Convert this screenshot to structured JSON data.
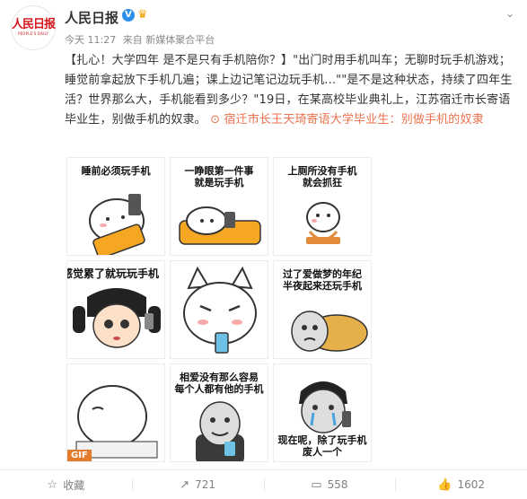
{
  "account": {
    "logo_text": "人民日报",
    "logo_sub": "PEOPLE'S DAILY",
    "name": "人民日报",
    "verified_mark": "V",
    "badge_icon": "crown-icon"
  },
  "post": {
    "time": "今天 11:27",
    "source": "来自 新媒体聚合平台",
    "text": "【扎心！大学四年 是不是只有手机陪你？】\"出门时用手机叫车；无聊时玩手机游戏；睡觉前拿起放下手机几遍；课上边记笔记边玩手机...\"\"是不是这种状态，持续了四年生活？世界那么大，手机能看到多少？\"19日，在某高校毕业典礼上，江苏宿迁市长寄语毕业生，别做手机的奴隶。",
    "link_text": "宿迁市长王天琦寄语大学毕业生：别做手机的奴隶"
  },
  "images": [
    {
      "caption": "睡前必须玩手机"
    },
    {
      "caption": "一睁眼第一件事\n就是玩手机"
    },
    {
      "caption": "上厕所没有手机\n就会抓狂"
    },
    {
      "caption": "感觉累了就玩玩手机"
    },
    {
      "caption": ""
    },
    {
      "caption": "过了爱做梦的年纪\n半夜起来还玩手机"
    },
    {
      "caption": "",
      "gif": "GIF"
    },
    {
      "caption": "相爱没有那么容易\n每个人都有他的手机"
    },
    {
      "caption": "现在呢，除了玩手机\n废人一个"
    }
  ],
  "actions": {
    "favorite": "收藏",
    "repost": "721",
    "comment": "558",
    "like": "1602"
  },
  "colors": {
    "brand_red": "#d5141b",
    "link_orange": "#eb7350",
    "verified_blue": "#2c8fe8"
  }
}
